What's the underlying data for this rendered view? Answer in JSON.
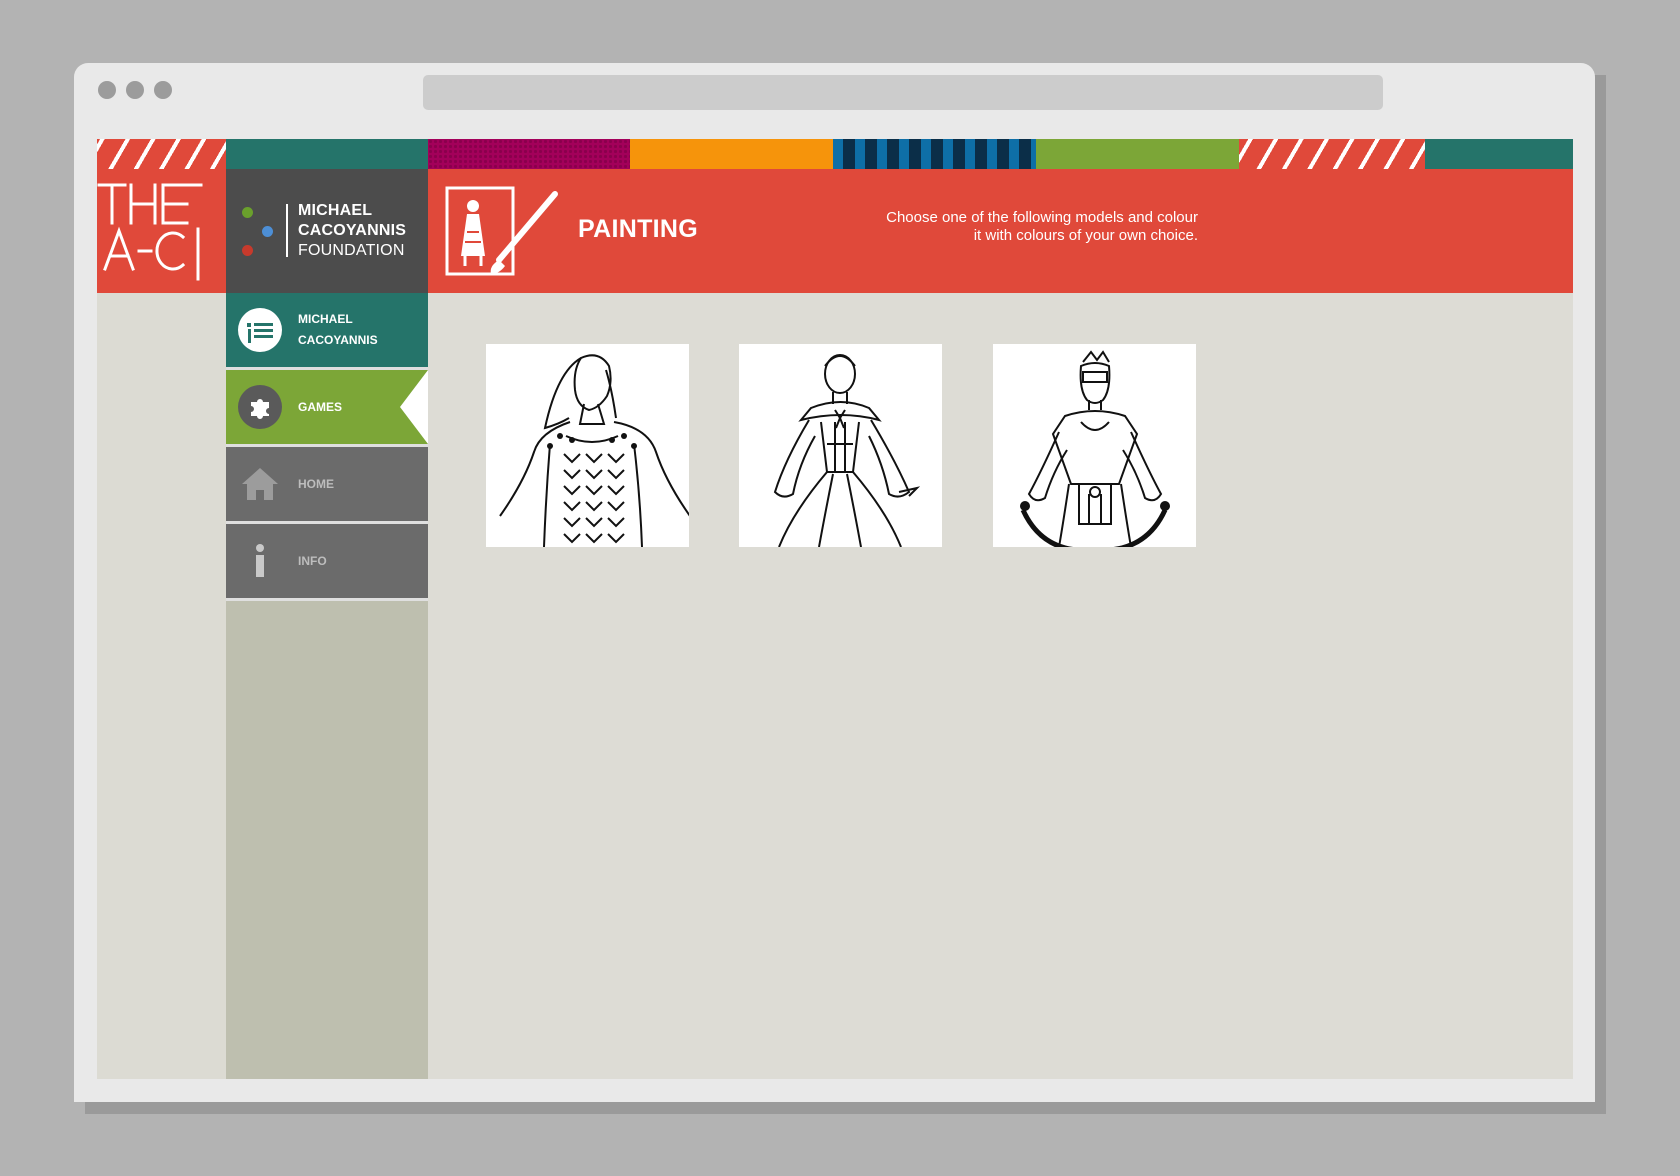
{
  "browser": {
    "window_controls": [
      "dot",
      "dot",
      "dot"
    ]
  },
  "logo": {
    "text": "THE A-C"
  },
  "brand": {
    "line1": "MICHAEL",
    "line2": "CACOYANNIS",
    "line3": "FOUNDATION",
    "dot_colors": [
      "#6aa02c",
      "#4d8fd6",
      "#c73a2c"
    ]
  },
  "nav": {
    "items": [
      {
        "label_line1": "MICHAEL",
        "label_line2": "CACOYANNIS",
        "icon": "list-icon",
        "state": "normal"
      },
      {
        "label": "GAMES",
        "icon": "puzzle-icon",
        "state": "active"
      },
      {
        "label": "HOME",
        "icon": "home-icon",
        "state": "normal"
      },
      {
        "label": "INFO",
        "icon": "info-icon",
        "state": "normal"
      }
    ]
  },
  "header": {
    "icon": "painting-icon",
    "title": "PAINTING",
    "instructions_line1": "Choose one of the following models and colour",
    "instructions_line2": "it with colours of your own choice."
  },
  "models": [
    {
      "name": "costume-model-1"
    },
    {
      "name": "costume-model-2"
    },
    {
      "name": "costume-model-3"
    }
  ],
  "colors": {
    "accent_red": "#e0493a",
    "teal": "#25746a",
    "green": "#7ca637",
    "orange": "#f6940b",
    "magenta": "#a3005a",
    "gray_nav": "#6b6b6b",
    "brand_gray": "#4c4c4c"
  }
}
